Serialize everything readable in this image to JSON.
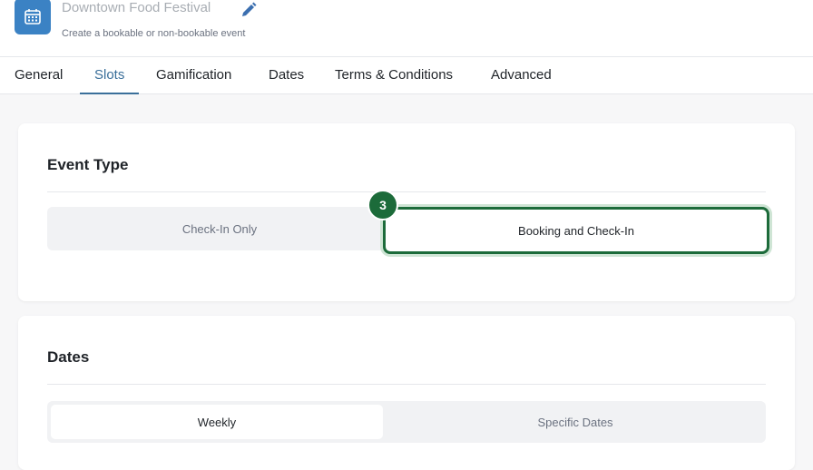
{
  "header": {
    "title": "Downtown Food Festival",
    "subtitle": "Create a bookable or non-bookable event"
  },
  "tabs": [
    {
      "label": "General"
    },
    {
      "label": "Slots"
    },
    {
      "label": "Gamification"
    },
    {
      "label": "Dates"
    },
    {
      "label": "Terms & Conditions"
    },
    {
      "label": "Advanced"
    }
  ],
  "active_tab": "Slots",
  "event_type": {
    "title": "Event Type",
    "options": [
      "Check-In Only",
      "Booking and Check-In"
    ],
    "selected": "Booking and Check-In",
    "step_badge": "3"
  },
  "dates": {
    "title": "Dates",
    "options": [
      "Weekly",
      "Specific Dates"
    ],
    "selected": "Weekly"
  },
  "colors": {
    "accent": "#3a6f9a",
    "app_icon": "#3b82c4",
    "highlight": "#1c6b3a"
  }
}
